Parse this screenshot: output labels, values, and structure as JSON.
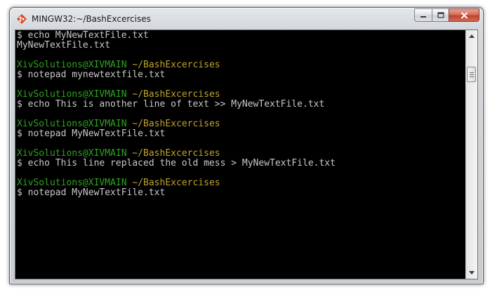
{
  "window": {
    "title": "MINGW32:~/BashExcercises",
    "app_icon": "git-bash-icon",
    "buttons": {
      "minimize": "minimize-icon",
      "maximize": "maximize-icon",
      "close": "close-icon"
    }
  },
  "colors": {
    "terminal_background": "#000000",
    "text": "#c8c8c8",
    "user_host": "#2ea31f",
    "path": "#c0a22a",
    "close_button": "#c2432f"
  },
  "terminal": {
    "lines": [
      {
        "type": "command",
        "text": "$ echo MyNewTextFile.txt"
      },
      {
        "type": "output",
        "text": "MyNewTextFile.txt"
      },
      {
        "type": "blank",
        "text": ""
      },
      {
        "type": "prompt",
        "user_host": "XivSolutions@XIVMAIN",
        "path": " ~/BashExcercises"
      },
      {
        "type": "command",
        "text": "$ notepad mynewtextfile.txt"
      },
      {
        "type": "blank",
        "text": ""
      },
      {
        "type": "prompt",
        "user_host": "XivSolutions@XIVMAIN",
        "path": " ~/BashExcercises"
      },
      {
        "type": "command",
        "text": "$ echo This is another line of text >> MyNewTextFile.txt"
      },
      {
        "type": "blank",
        "text": ""
      },
      {
        "type": "prompt",
        "user_host": "XivSolutions@XIVMAIN",
        "path": " ~/BashExcercises"
      },
      {
        "type": "command",
        "text": "$ notepad MyNewTextFile.txt"
      },
      {
        "type": "blank",
        "text": ""
      },
      {
        "type": "prompt",
        "user_host": "XivSolutions@XIVMAIN",
        "path": " ~/BashExcercises"
      },
      {
        "type": "command",
        "text": "$ echo This line replaced the old mess > MyNewTextFile.txt"
      },
      {
        "type": "blank",
        "text": ""
      },
      {
        "type": "prompt",
        "user_host": "XivSolutions@XIVMAIN",
        "path": " ~/BashExcercises"
      },
      {
        "type": "command",
        "text": "$ notepad MyNewTextFile.txt"
      }
    ]
  },
  "scrollbar": {
    "up_icon": "scroll-up-arrow-icon",
    "down_icon": "scroll-down-arrow-icon"
  }
}
